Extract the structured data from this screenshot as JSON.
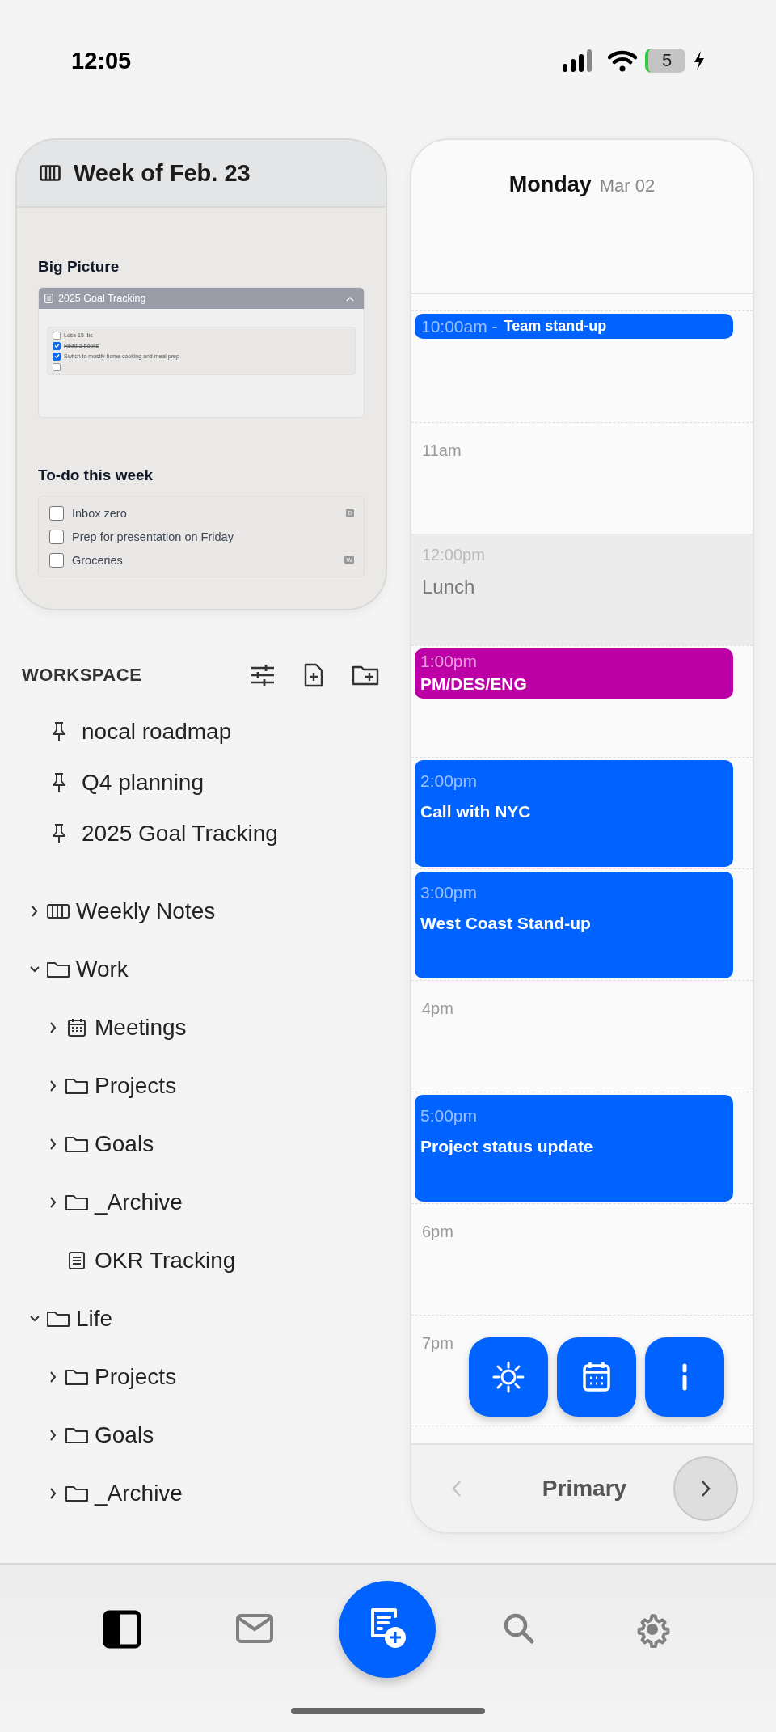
{
  "status_bar": {
    "time": "12:05",
    "battery": "5"
  },
  "week_card": {
    "title": "Week of Feb. 23",
    "sections": [
      {
        "heading": "Big Picture",
        "embed": {
          "title": "2025 Goal Tracking",
          "expanded": true,
          "items": [
            {
              "text": "Lose 15 lbs",
              "checked": false
            },
            {
              "text": "Read 5 books",
              "checked": true
            },
            {
              "text": "Switch to mostly home cooking and meal prep",
              "checked": true
            },
            {
              "checked": false
            }
          ]
        }
      },
      {
        "heading": "To-do this week",
        "todos": [
          {
            "text": "Inbox zero",
            "checked": false,
            "tag": "D"
          },
          {
            "text": "Prep for presentation on Friday",
            "checked": false
          },
          {
            "text": "Groceries",
            "checked": false,
            "tag": "W"
          }
        ]
      }
    ]
  },
  "workspace": {
    "title": "WORKSPACE",
    "pinned": [
      {
        "label": "nocal roadmap"
      },
      {
        "label": "Q4 planning"
      },
      {
        "label": "2025 Goal Tracking"
      }
    ],
    "tree": [
      {
        "label": "Weekly Notes",
        "kind": "columns",
        "expanded": false
      },
      {
        "label": "Work",
        "kind": "folder",
        "expanded": true,
        "children": [
          {
            "label": "Meetings",
            "kind": "calendar",
            "expanded": false
          },
          {
            "label": "Projects",
            "kind": "folder",
            "expanded": false
          },
          {
            "label": "Goals",
            "kind": "folder",
            "expanded": false
          },
          {
            "label": "_Archive",
            "kind": "folder",
            "expanded": false
          },
          {
            "label": "OKR Tracking",
            "kind": "note"
          }
        ]
      },
      {
        "label": "Life",
        "kind": "folder",
        "expanded": true,
        "children": [
          {
            "label": "Projects",
            "kind": "folder",
            "expanded": false
          },
          {
            "label": "Goals",
            "kind": "folder",
            "expanded": false
          },
          {
            "label": "_Archive",
            "kind": "folder",
            "expanded": false
          }
        ]
      }
    ]
  },
  "calendar": {
    "day": "Monday",
    "date": "Mar 02",
    "hours": [
      {
        "event": {
          "kind": "inline",
          "time": "10:00am -",
          "title": "Team stand-up",
          "color": "#0062ff"
        }
      },
      {
        "label": "11am"
      },
      {
        "event": {
          "kind": "muted",
          "time": "12:00pm",
          "title": "Lunch",
          "color": "#ececec"
        }
      },
      {
        "event": {
          "kind": "short",
          "time": "1:00pm",
          "title": "PM/DES/ENG",
          "color": "#bd00a6"
        }
      },
      {
        "event": {
          "kind": "card",
          "time": "2:00pm",
          "title": "Call with NYC",
          "color": "#0062ff"
        }
      },
      {
        "event": {
          "kind": "card",
          "time": "3:00pm",
          "title": "West Coast Stand-up",
          "color": "#0062ff"
        }
      },
      {
        "label": "4pm"
      },
      {
        "event": {
          "kind": "card",
          "time": "5:00pm",
          "title": "Project status update",
          "color": "#0062ff"
        }
      },
      {
        "label": "6pm"
      },
      {
        "label": "7pm"
      }
    ],
    "footer": {
      "label": "Primary",
      "prev_disabled": true
    }
  },
  "tab_bar": [
    {
      "kind": "sidebar",
      "selected": true
    },
    {
      "kind": "mail",
      "selected": false
    },
    {
      "kind": "compose",
      "selected": false
    },
    {
      "kind": "search",
      "selected": false
    },
    {
      "kind": "settings",
      "selected": false
    }
  ]
}
